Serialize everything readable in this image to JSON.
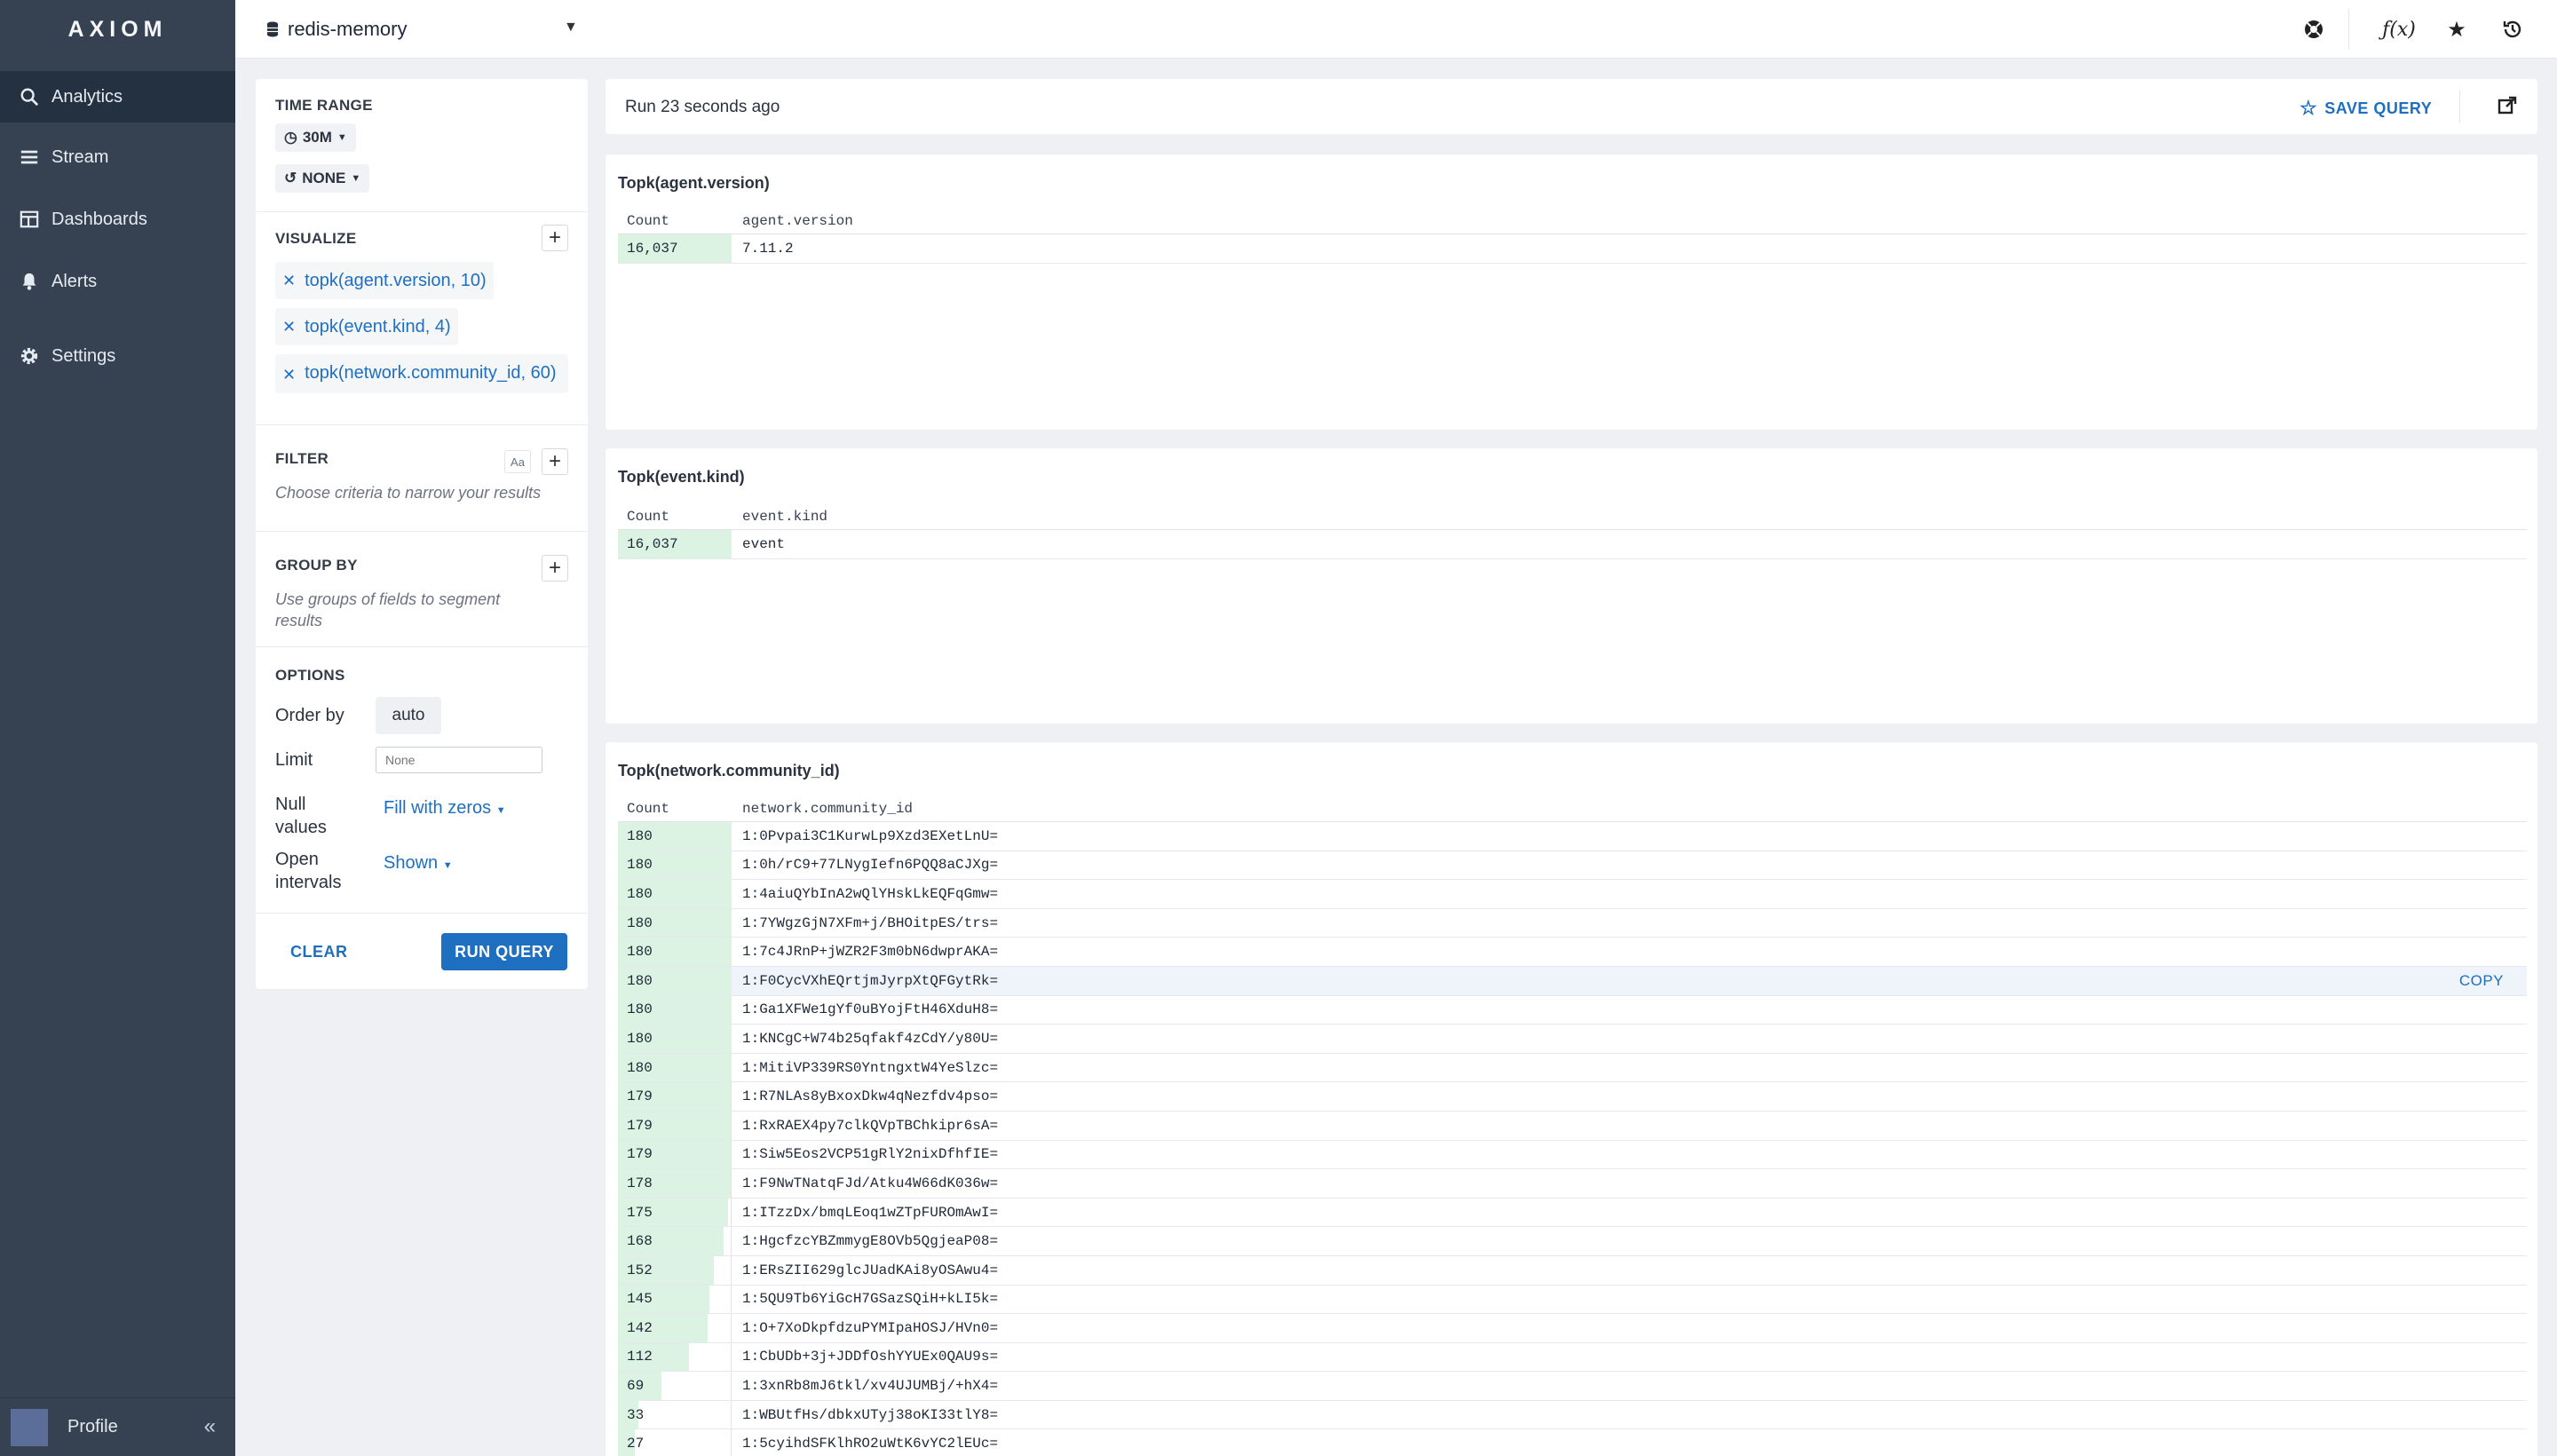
{
  "app": {
    "logo": "AXIOM"
  },
  "sidebar": {
    "items": [
      {
        "label": "Analytics",
        "icon": "search-icon"
      },
      {
        "label": "Stream",
        "icon": "stream-icon"
      },
      {
        "label": "Dashboards",
        "icon": "dashboard-icon"
      },
      {
        "label": "Alerts",
        "icon": "bell-icon"
      },
      {
        "label": "Settings",
        "icon": "gear-icon"
      }
    ],
    "profile_label": "Profile",
    "collapse_glyph": "«"
  },
  "topbar": {
    "dataset": "redis-memory"
  },
  "query": {
    "time_range_title": "TIME RANGE",
    "time_range_value": "30M",
    "compare_value": "NONE",
    "visualize_title": "VISUALIZE",
    "visualizations": [
      "topk(agent.version, 10)",
      "topk(event.kind, 4)",
      "topk(network.community_id, 60)"
    ],
    "filter_title": "FILTER",
    "filter_case": "Aa",
    "filter_hint": "Choose criteria to narrow your results",
    "group_title": "GROUP BY",
    "group_hint": "Use groups of fields to segment results",
    "options_title": "OPTIONS",
    "order_by_label": "Order by",
    "order_by_value": "auto",
    "limit_label": "Limit",
    "limit_placeholder": "None",
    "null_label": "Null values",
    "null_value": "Fill with zeros",
    "intervals_label": "Open intervals",
    "intervals_value": "Shown",
    "clear_label": "CLEAR",
    "run_label": "RUN QUERY"
  },
  "results_header": {
    "run_status": "Run 23 seconds ago",
    "save_label": "SAVE QUERY"
  },
  "results": [
    {
      "title": "Topk(agent.version)",
      "col_count": "Count",
      "col_field": "agent.version",
      "rows": [
        {
          "count": "16,037",
          "value": "7.11.2",
          "frac": 1.0
        }
      ]
    },
    {
      "title": "Topk(event.kind)",
      "col_count": "Count",
      "col_field": "event.kind",
      "rows": [
        {
          "count": "16,037",
          "value": "event",
          "frac": 1.0
        }
      ]
    },
    {
      "title": "Topk(network.community_id)",
      "col_count": "Count",
      "col_field": "network.community_id",
      "copy_label": "COPY",
      "rows": [
        {
          "count": "180",
          "value": "1:0Pvpai3C1KurwLp9Xzd3EXetLnU=",
          "frac": 1.0
        },
        {
          "count": "180",
          "value": "1:0h/rC9+77LNygIefn6PQQ8aCJXg=",
          "frac": 1.0
        },
        {
          "count": "180",
          "value": "1:4aiuQYbInA2wQlYHskLkEQFqGmw=",
          "frac": 1.0
        },
        {
          "count": "180",
          "value": "1:7YWgzGjN7XFm+j/BHOitpES/trs=",
          "frac": 1.0
        },
        {
          "count": "180",
          "value": "1:7c4JRnP+jWZR2F3m0bN6dwprAKA=",
          "frac": 1.0
        },
        {
          "count": "180",
          "value": "1:F0CycVXhEQrtjmJyrpXtQFGytRk=",
          "frac": 1.0
        },
        {
          "count": "180",
          "value": "1:Ga1XFWe1gYf0uBYojFtH46XduH8=",
          "frac": 1.0
        },
        {
          "count": "180",
          "value": "1:KNCgC+W74b25qfakf4zCdY/y80U=",
          "frac": 1.0
        },
        {
          "count": "180",
          "value": "1:MitiVP339RS0YntngxtW4YeSlzc=",
          "frac": 1.0
        },
        {
          "count": "179",
          "value": "1:R7NLAs8yBxoxDkw4qNezfdv4pso=",
          "frac": 0.994
        },
        {
          "count": "179",
          "value": "1:RxRAEX4py7clkQVpTBChkipr6sA=",
          "frac": 0.994
        },
        {
          "count": "179",
          "value": "1:Siw5Eos2VCP51gRlY2nixDfhfIE=",
          "frac": 0.994
        },
        {
          "count": "178",
          "value": "1:F9NwTNatqFJd/Atku4W66dK036w=",
          "frac": 0.989
        },
        {
          "count": "175",
          "value": "1:ITzzDx/bmqLEoq1wZTpFUROmAwI=",
          "frac": 0.972
        },
        {
          "count": "168",
          "value": "1:HgcfzcYBZmmygE8OVb5QgjeaP08=",
          "frac": 0.933
        },
        {
          "count": "152",
          "value": "1:ERsZII629glcJUadKAi8yOSAwu4=",
          "frac": 0.844
        },
        {
          "count": "145",
          "value": "1:5QU9Tb6YiGcH7GSazSQiH+kLI5k=",
          "frac": 0.806
        },
        {
          "count": "142",
          "value": "1:O+7XoDkpfdzuPYMIpaHOSJ/HVn0=",
          "frac": 0.789
        },
        {
          "count": "112",
          "value": "1:CbUDb+3j+JDDfOshYYUEx0QAU9s=",
          "frac": 0.622
        },
        {
          "count": "69",
          "value": "1:3xnRb8mJ6tkl/xv4UJUMBj/+hX4=",
          "frac": 0.383
        },
        {
          "count": "33",
          "value": "1:WBUtfHs/dbkxUTyj38oKI33tlY8=",
          "frac": 0.183
        },
        {
          "count": "27",
          "value": "1:5cyihdSFKlhRO2uWtK6vYC2lEUc=",
          "frac": 0.15
        }
      ]
    }
  ],
  "colors": {
    "sidebar": "#364252",
    "accent": "#1f6fc0",
    "bar": "#dcf2e3"
  }
}
